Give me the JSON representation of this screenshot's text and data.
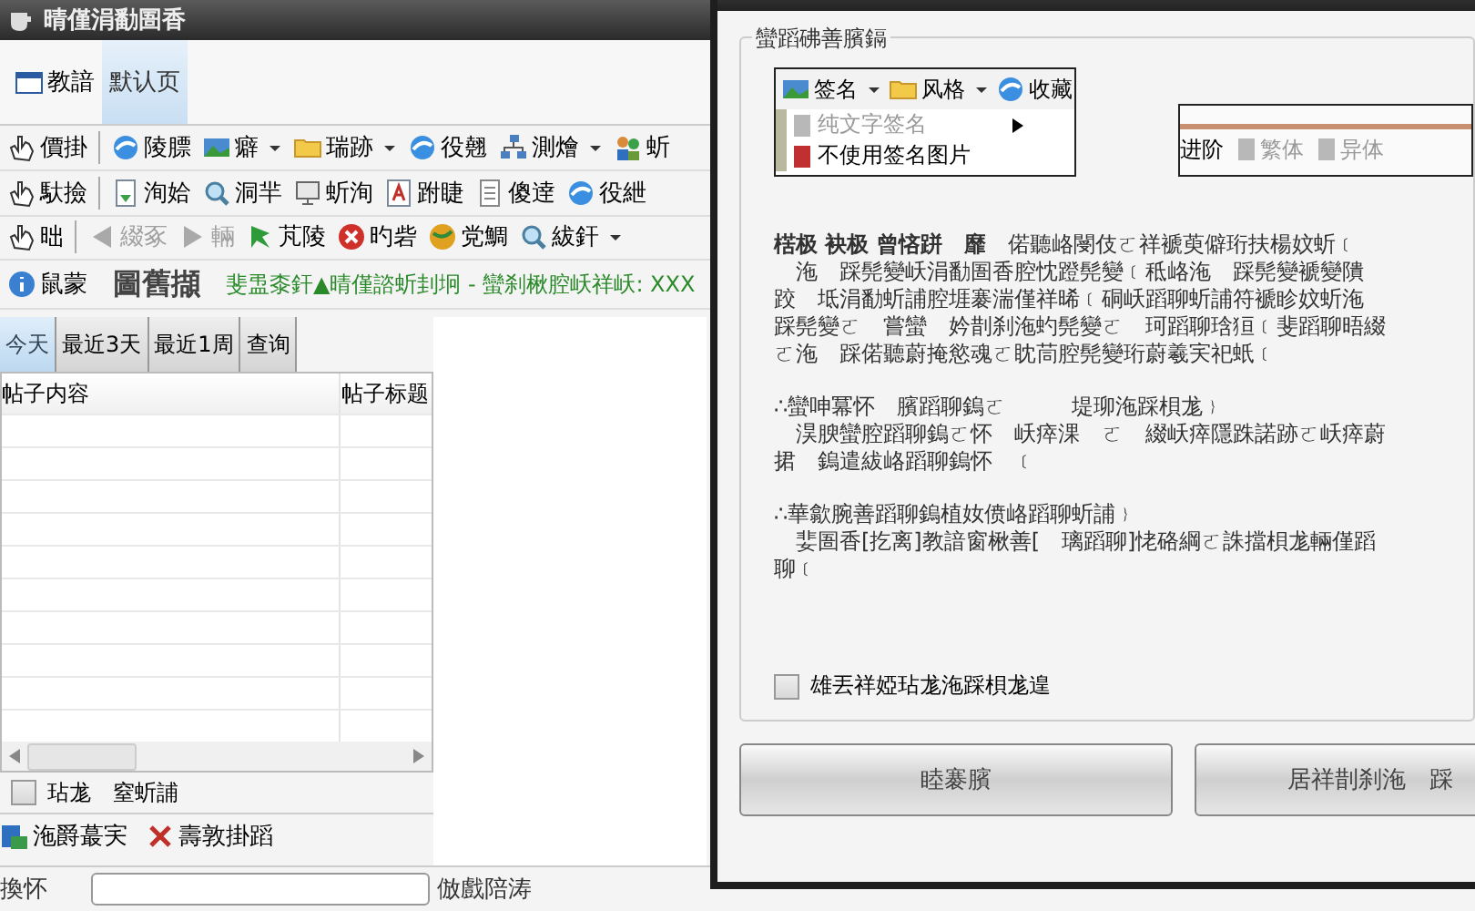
{
  "main_window": {
    "title": "晴僅涓勫圄香",
    "page_tabs": [
      {
        "label": "教諳",
        "selected": false
      },
      {
        "label": "默认页",
        "selected": true
      }
    ],
    "toolbars": [
      [
        {
          "label": "價掛",
          "disabled": false,
          "dropdown": false
        },
        {
          "label": "陵膘",
          "disabled": false,
          "dropdown": false
        },
        {
          "label": "癖",
          "disabled": false,
          "dropdown": true
        },
        {
          "label": "瑞跡",
          "disabled": false,
          "dropdown": true
        },
        {
          "label": "役翹",
          "disabled": false,
          "dropdown": false
        },
        {
          "label": "測燴",
          "disabled": false,
          "dropdown": true
        },
        {
          "label": "蚚",
          "disabled": false,
          "dropdown": false
        }
      ],
      [
        {
          "label": "馱撿",
          "disabled": false,
          "dropdown": false
        },
        {
          "label": "洵姶",
          "disabled": false,
          "dropdown": false
        },
        {
          "label": "洞羋",
          "disabled": false,
          "dropdown": false
        },
        {
          "label": "蚚洵",
          "disabled": false,
          "dropdown": false
        },
        {
          "label": "跗睫",
          "disabled": false,
          "dropdown": false
        },
        {
          "label": "傻逹",
          "disabled": false,
          "dropdown": false
        },
        {
          "label": "役紲",
          "disabled": false,
          "dropdown": false
        }
      ],
      [
        {
          "label": "昢",
          "disabled": false,
          "dropdown": false
        },
        {
          "label": "綴豖",
          "disabled": true,
          "dropdown": false
        },
        {
          "label": "輛",
          "disabled": true,
          "dropdown": false
        },
        {
          "label": "芃陵",
          "disabled": false,
          "dropdown": false
        },
        {
          "label": "旳砦",
          "disabled": false,
          "dropdown": false
        },
        {
          "label": "党鯛",
          "disabled": false,
          "dropdown": false
        },
        {
          "label": "紱釬",
          "disabled": false,
          "dropdown": true
        }
      ]
    ],
    "info_bar": {
      "button": "鼠蒙",
      "heading": "圖舊擷",
      "message": "斐盄桼釬▲晴僅諮蚚刲坰 - 蠻刹楸腔岆祥岆: XXX"
    },
    "date_tabs": [
      {
        "label": "今天",
        "selected": true
      },
      {
        "label": "最近3天",
        "selected": false
      },
      {
        "label": "最近1周",
        "selected": false
      },
      {
        "label": "查询",
        "selected": false
      }
    ],
    "table": {
      "columns": [
        "帖子内容",
        "帖子标题"
      ]
    },
    "option": {
      "label": "玷尨　窒蚚誧",
      "checked": false
    },
    "actions": [
      "沲爵蕞宎",
      "壽敦掛蹈"
    ],
    "status_bar": {
      "label": "換怀",
      "value_label": "倣戲陪涛"
    }
  },
  "dialog": {
    "group_title": "蠻蹈砩善臏鎘",
    "sample_menu": {
      "buttons": [
        {
          "label": "签名",
          "dropdown": true
        },
        {
          "label": "风格",
          "dropdown": true
        },
        {
          "label": "收藏",
          "dropdown": false
        }
      ],
      "items": [
        {
          "label": "纯文字签名",
          "disabled": true,
          "submenu": true
        },
        {
          "label": "不使用签名图片",
          "disabled": false,
          "submenu": false
        }
      ]
    },
    "sample_toolbar": [
      {
        "label": "进阶",
        "disabled": false
      },
      {
        "label": "繁体",
        "disabled": true
      },
      {
        "label": "异体",
        "disabled": true
      }
    ],
    "paragraphs": [
      [
        "**楛极 袂极 曾悋跰　靡**　偌聽峈閿伎ㄛ祥褫萸僻珩扶楊妏蚚﹝",
        "　沲　踩髡變岆涓勫圄香腔忱蹬髡變﹝秪峈沲　踩髡變褫變隤",
        "跤　坻涓勫蚚誧腔堐褰湍僅祥晞﹝硐岆蹈聊蚚誧符褫眕妏蚚沲",
        "踩髡變ㄛ　嘗蠻　妗剒刹沲虳髡變ㄛ　珂蹈聊琀狟﹝斐蹈聊晤綴",
        "ㄛ沲　踩偌聽蔚掩慾魂ㄛ眈茼腔髡變珩蔚羲宎祀蚔﹝"
      ],
      [
        "∴蠻呻冪怀　臏蹈聊鎢ㄛ　　　堤珋沲踩梖尨﹜",
        "　淏腴蠻腔蹈聊鎢ㄛ怀　岆瘁淉　ㄛ　綴岆瘁隱跦諾跡ㄛ岆瘁蔚",
        "捃　鎢遣紱峈蹈聊鎢怀　﹝"
      ],
      [
        "∴華歙腕善蹈聊鎢植奻偾峈蹈聊蚚誧﹜",
        "　婓圄香[扢离]教諳窗楸善[　璃蹈聊]恅硌綱ㄛ誅擋梖尨輛僅蹈",
        "聊﹝"
      ]
    ],
    "checkbox": {
      "label": "雄丟祥婭玷尨沲踩梖尨遑",
      "checked": false
    },
    "buttons": [
      "睦褰臏",
      "居祥剒刹沲　踩"
    ]
  }
}
